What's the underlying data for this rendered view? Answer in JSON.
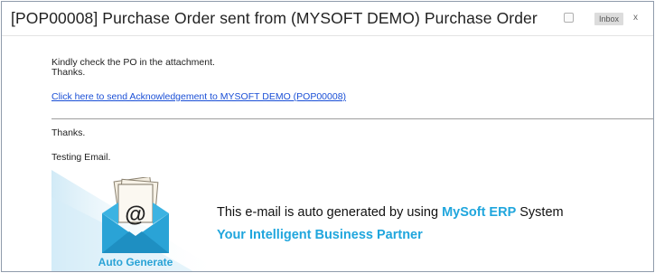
{
  "email": {
    "subject": "[POP00008] Purchase Order sent from (MYSOFT DEMO) Purchase Order",
    "label_badge": "Inbox",
    "label_close": "x",
    "body_line1": "Kindly check the PO in the attachment.",
    "body_line2": "Thanks.",
    "ack_link": "Click here to send Acknowledgement to MYSOFT DEMO (POP00008)",
    "thanks": "Thanks.",
    "testing": "Testing Email."
  },
  "banner": {
    "line1_prefix": "This e-mail is auto generated by using ",
    "line1_brand": "MySoft ERP",
    "line1_suffix": " System",
    "line2": "Your Intelligent Business Partner",
    "auto_generate": "Auto Generate",
    "envelope_symbol": "@",
    "icon": "envelope-at-icon"
  },
  "colors": {
    "brand_blue": "#20a6dd",
    "link_blue": "#1a4fd6",
    "banner_wash": "#d9eef8"
  }
}
